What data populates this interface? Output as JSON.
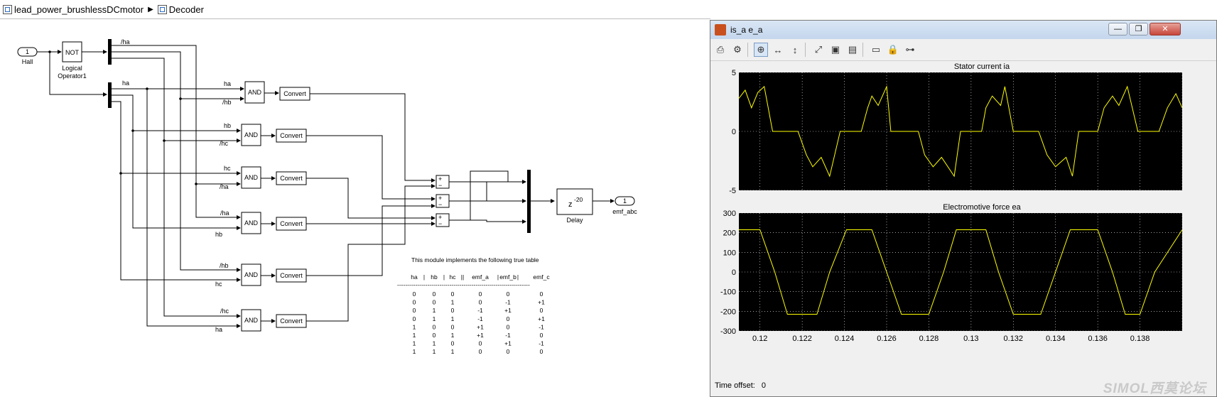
{
  "breadcrumb": {
    "model": "lead_power_brushlessDCmotor",
    "subsystem": "Decoder"
  },
  "blocks": {
    "hall_in": {
      "port": "1",
      "label": "Hall"
    },
    "not": {
      "text": "NOT",
      "label1": "Logical",
      "label2": "Operator1"
    },
    "and_label": "AND",
    "convert_label": "Convert",
    "delay": {
      "base": "z",
      "exp": "-20",
      "label": "Delay"
    },
    "emf_out": {
      "port": "1",
      "label": "emf_abc"
    },
    "sum_signs": {
      "plus": "+",
      "minus": "−"
    }
  },
  "signals": {
    "ha_n": "/ha",
    "ha": "ha",
    "gate1": [
      "ha",
      "/hb"
    ],
    "gate2": [
      "hb",
      "/hc"
    ],
    "gate3": [
      "hc",
      "/ha"
    ],
    "gate4": [
      "/ha",
      "hb"
    ],
    "gate5": [
      "/hb",
      "hc"
    ],
    "gate6": [
      "/hc",
      "ha"
    ]
  },
  "truth_table": {
    "caption": "This module implements the following true table",
    "header": [
      "ha",
      "|",
      "hb",
      "|",
      "hc",
      "||",
      "emf_a",
      "|",
      "emf_b",
      "|",
      "emf_c"
    ],
    "rule": "------------------------------------------------------------------",
    "rows": [
      [
        "0",
        "0",
        "0",
        "0",
        "0",
        "0"
      ],
      [
        "0",
        "0",
        "1",
        "0",
        "-1",
        "+1"
      ],
      [
        "0",
        "1",
        "0",
        "-1",
        "+1",
        "0"
      ],
      [
        "0",
        "1",
        "1",
        "-1",
        "0",
        "+1"
      ],
      [
        "1",
        "0",
        "0",
        "+1",
        "0",
        "-1"
      ],
      [
        "1",
        "0",
        "1",
        "+1",
        "-1",
        "0"
      ],
      [
        "1",
        "1",
        "0",
        "0",
        "+1",
        "-1"
      ],
      [
        "1",
        "1",
        "1",
        "0",
        "0",
        "0"
      ]
    ]
  },
  "scope": {
    "title": "is_a e_a",
    "window_buttons": {
      "minimize": "—",
      "restore": "❐",
      "close": "✕"
    },
    "toolbar": [
      {
        "name": "print-icon",
        "glyph": "⎙"
      },
      {
        "name": "parameters-icon",
        "glyph": "⚙"
      },
      {
        "name": "zoom-in-icon",
        "glyph": "⊕"
      },
      {
        "name": "zoom-x-icon",
        "glyph": "↔"
      },
      {
        "name": "zoom-y-icon",
        "glyph": "↕"
      },
      {
        "name": "autoscale-icon",
        "glyph": "⤢"
      },
      {
        "name": "save-axes-icon",
        "glyph": "▣"
      },
      {
        "name": "restore-axes-icon",
        "glyph": "▤"
      },
      {
        "name": "floating-scope-icon",
        "glyph": "▭"
      },
      {
        "name": "lock-axes-icon",
        "glyph": "🔒"
      },
      {
        "name": "signal-selector-icon",
        "glyph": "⊶"
      }
    ],
    "time_offset_label": "Time offset:",
    "time_offset_value": "0",
    "watermark": "SIMOL西莫论坛",
    "colors": {
      "plot_bg": "#000000",
      "trace": "#ffff00",
      "grid": "#ffffff"
    }
  },
  "chart_data": [
    {
      "type": "line",
      "title": "Stator current ia",
      "xlim": [
        0.119,
        0.14
      ],
      "ylim": [
        -5,
        5
      ],
      "yticks": [
        "5",
        "0",
        "-5"
      ],
      "xticks": [],
      "grid": true,
      "series": [
        {
          "x": [
            0.119,
            0.1193,
            0.1196,
            0.1199,
            0.1202,
            0.1206,
            0.1208,
            0.1213,
            0.1218,
            0.1222,
            0.1225,
            0.1229,
            0.1233,
            0.1238,
            0.1241,
            0.1245,
            0.1248,
            0.1251,
            0.1253,
            0.1256,
            0.126,
            0.1262,
            0.1267,
            0.1272,
            0.1275,
            0.1278,
            0.1282,
            0.1286,
            0.1292,
            0.1295,
            0.1298,
            0.1301,
            0.1305,
            0.1307,
            0.131,
            0.1314,
            0.1316,
            0.132,
            0.1326,
            0.1328,
            0.1332,
            0.1336,
            0.134,
            0.1345,
            0.1348,
            0.1351,
            0.1354,
            0.1358,
            0.136,
            0.1363,
            0.1367,
            0.137,
            0.1374,
            0.1379,
            0.1382,
            0.1385,
            0.1389,
            0.1393,
            0.1397,
            0.14
          ],
          "y": [
            2.8,
            3.5,
            2,
            3.3,
            3.8,
            0,
            0,
            0,
            0,
            -2,
            -3,
            -2.2,
            -3.8,
            0,
            0,
            0,
            0,
            2,
            3,
            2.2,
            3.8,
            0,
            0,
            0,
            0,
            -2,
            -3,
            -2.2,
            -3.8,
            0,
            0,
            0,
            0,
            2,
            3,
            2.2,
            3.8,
            0,
            0,
            0,
            0,
            -2,
            -3,
            -2.2,
            -3.8,
            0,
            0,
            0,
            0,
            2,
            3,
            2.2,
            3.8,
            0,
            0,
            0,
            0,
            2,
            3.2,
            2
          ]
        }
      ]
    },
    {
      "type": "line",
      "title": "Electromotive force ea",
      "xlim": [
        0.119,
        0.14
      ],
      "ylim": [
        -300,
        300
      ],
      "yticks": [
        "300",
        "200",
        "100",
        "0",
        "-100",
        "-200",
        "-300"
      ],
      "xticks": [
        "0.12",
        "0.122",
        "0.124",
        "0.126",
        "0.128",
        "0.13",
        "0.132",
        "0.134",
        "0.136",
        "0.138"
      ],
      "grid": true,
      "series": [
        {
          "x": [
            0.119,
            0.12,
            0.1207,
            0.1213,
            0.122,
            0.1227,
            0.1233,
            0.1241,
            0.1247,
            0.1253,
            0.126,
            0.1267,
            0.1273,
            0.128,
            0.1287,
            0.1293,
            0.1301,
            0.1307,
            0.1313,
            0.132,
            0.1327,
            0.1333,
            0.134,
            0.1347,
            0.1353,
            0.136,
            0.1367,
            0.1373,
            0.138,
            0.1387,
            0.14
          ],
          "y": [
            215,
            215,
            0,
            -215,
            -215,
            -215,
            0,
            215,
            215,
            215,
            0,
            -215,
            -215,
            -215,
            0,
            215,
            215,
            215,
            0,
            -215,
            -215,
            -215,
            0,
            215,
            215,
            215,
            0,
            -215,
            -215,
            0,
            215
          ]
        }
      ]
    }
  ]
}
